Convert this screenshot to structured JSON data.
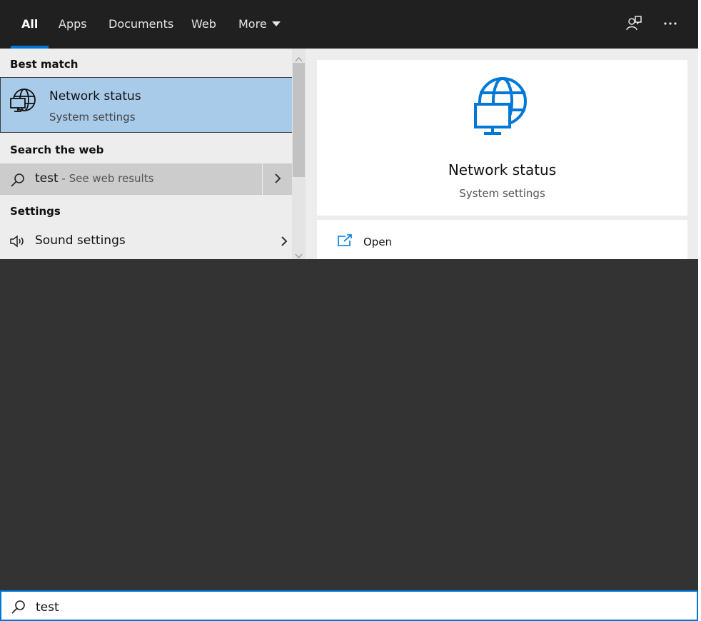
{
  "tabs": [
    {
      "label": "All",
      "active": true
    },
    {
      "label": "Apps"
    },
    {
      "label": "Documents"
    },
    {
      "label": "Web"
    },
    {
      "label": "More"
    }
  ],
  "top_icons": [
    "feedback-icon",
    "more-options-icon"
  ],
  "left_panel": {
    "best_match_heading": "Best match",
    "best_match": {
      "title": "Network status",
      "subtitle": "System settings",
      "icon": "network-globe-icon"
    },
    "web_heading": "Search the web",
    "web_result": {
      "query": "test",
      "suffix": " - See web results",
      "icon": "search-icon"
    },
    "settings_heading": "Settings",
    "settings_result": {
      "label": "Sound settings",
      "icon": "speaker-icon"
    }
  },
  "preview": {
    "title": "Network status",
    "subtitle": "System settings",
    "actions": [
      {
        "label": "Open",
        "icon": "open-icon"
      }
    ]
  },
  "search": {
    "value": "test"
  },
  "colors": {
    "accent": "#0078d7",
    "topbar": "#202020",
    "selection": "#a9cbea",
    "dark_area": "#333333"
  }
}
